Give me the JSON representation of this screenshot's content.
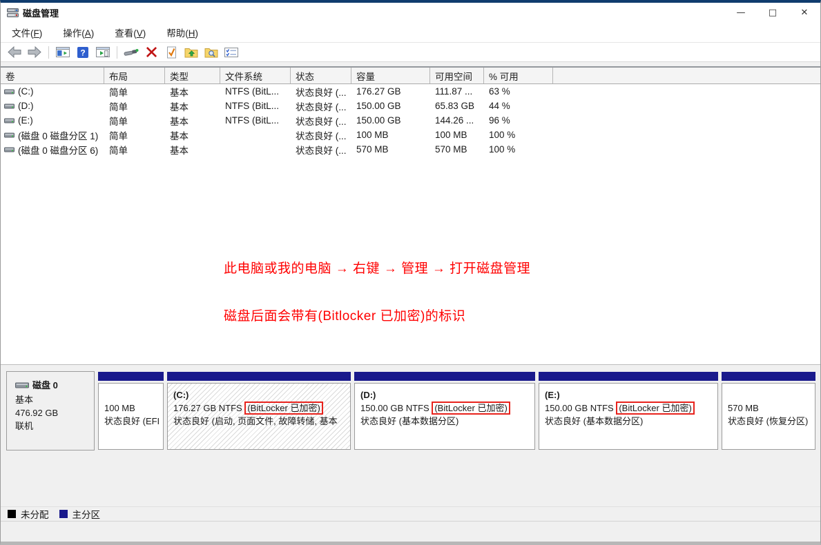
{
  "window": {
    "title": "磁盘管理",
    "controls": {
      "minimize": "—",
      "maximize": "□",
      "close": "✕"
    }
  },
  "menu": {
    "items": [
      {
        "pre": "文件(",
        "key": "F",
        "post": ")"
      },
      {
        "pre": "操作(",
        "key": "A",
        "post": ")"
      },
      {
        "pre": "查看(",
        "key": "V",
        "post": ")"
      },
      {
        "pre": "帮助(",
        "key": "H",
        "post": ")"
      }
    ]
  },
  "toolbar": {
    "icons": [
      "back",
      "forward",
      "show-console-tree",
      "help",
      "show-action-pane",
      "rescan-disks",
      "delete",
      "check-document",
      "folder-up",
      "folder-search",
      "properties"
    ]
  },
  "volume_table": {
    "headers": [
      "卷",
      "布局",
      "类型",
      "文件系统",
      "状态",
      "容量",
      "可用空间",
      "% 可用"
    ],
    "rows": [
      {
        "volume": "(C:)",
        "layout": "简单",
        "type": "基本",
        "filesystem": "NTFS (BitL...",
        "status": "状态良好 (...",
        "capacity": "176.27 GB",
        "free_space": "111.87 ...",
        "percent_free": "63 %"
      },
      {
        "volume": "(D:)",
        "layout": "简单",
        "type": "基本",
        "filesystem": "NTFS (BitL...",
        "status": "状态良好 (...",
        "capacity": "150.00 GB",
        "free_space": "65.83 GB",
        "percent_free": "44 %"
      },
      {
        "volume": "(E:)",
        "layout": "简单",
        "type": "基本",
        "filesystem": "NTFS (BitL...",
        "status": "状态良好 (...",
        "capacity": "150.00 GB",
        "free_space": "144.26 ...",
        "percent_free": "96 %"
      },
      {
        "volume": "(磁盘 0 磁盘分区 1)",
        "layout": "简单",
        "type": "基本",
        "filesystem": "",
        "status": "状态良好 (...",
        "capacity": "100 MB",
        "free_space": "100 MB",
        "percent_free": "100 %"
      },
      {
        "volume": "(磁盘 0 磁盘分区 6)",
        "layout": "简单",
        "type": "基本",
        "filesystem": "",
        "status": "状态良好 (...",
        "capacity": "570 MB",
        "free_space": "570 MB",
        "percent_free": "100 %"
      }
    ]
  },
  "annotations": {
    "line1": "此电脑或我的电脑 → 右键 → 管理 → 打开磁盘管理",
    "line2": "磁盘后面会带有(Bitlocker 已加密)的标识",
    "text_color": "#ff0000",
    "highlight_box_color": "#e8221c"
  },
  "disk_panel": {
    "disk": {
      "name": "磁盘 0",
      "type": "基本",
      "size": "476.92 GB",
      "status": "联机"
    },
    "partitions": [
      {
        "name": "",
        "info": "100 MB",
        "bitlocker": "",
        "status": "状态良好 (EFI"
      },
      {
        "name": "(C:)",
        "info": "176.27 GB NTFS ",
        "bitlocker": "(BitLocker 已加密)",
        "status": "状态良好 (启动, 页面文件, 故障转储, 基本"
      },
      {
        "name": "(D:)",
        "info": "150.00 GB NTFS ",
        "bitlocker": "(BitLocker 已加密)",
        "status": "状态良好 (基本数据分区)"
      },
      {
        "name": "(E:)",
        "info": "150.00 GB NTFS ",
        "bitlocker": "(BitLocker 已加密)",
        "status": "状态良好 (基本数据分区)"
      },
      {
        "name": "",
        "info": "570 MB",
        "bitlocker": "",
        "status": "状态良好 (恢复分区)"
      }
    ]
  },
  "legend": {
    "items": [
      {
        "label": "未分配",
        "color": "#000000"
      },
      {
        "label": "主分区",
        "color": "#1a1a8c"
      }
    ]
  },
  "colors": {
    "primary_partition": "#1a1a8c",
    "top_border_accent": "#103c6e"
  }
}
